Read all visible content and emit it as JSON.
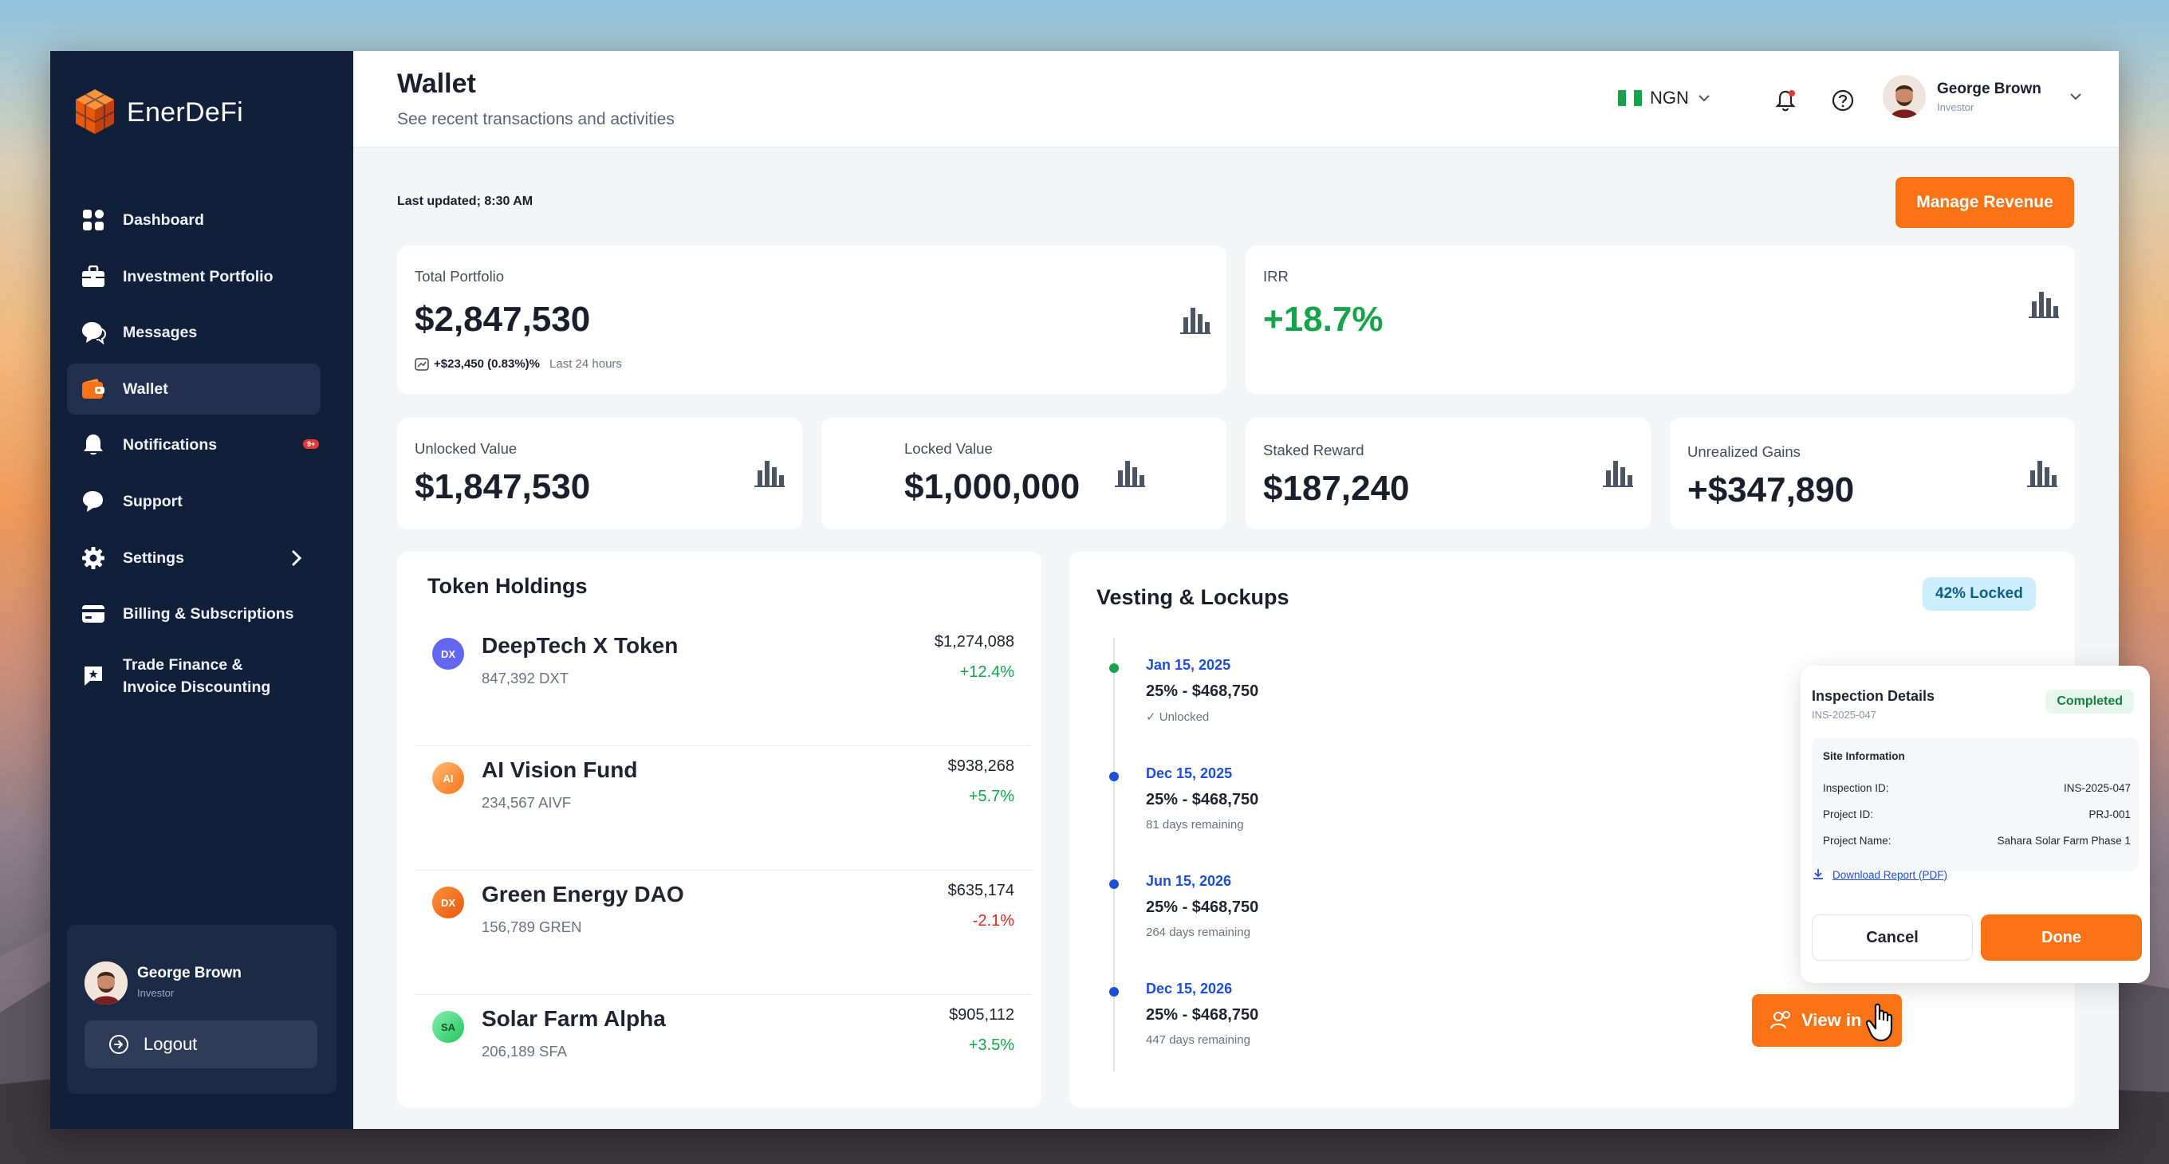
{
  "brand": {
    "name": "EnerDeFi"
  },
  "sidebar": {
    "items": [
      {
        "label": "Dashboard",
        "icon": "grid-icon"
      },
      {
        "label": "Investment Portfolio",
        "icon": "briefcase-icon"
      },
      {
        "label": "Messages",
        "icon": "chat-icon"
      },
      {
        "label": "Wallet",
        "icon": "wallet-icon",
        "active": true
      },
      {
        "label": "Notifications",
        "icon": "bell-icon",
        "badge": "9+"
      },
      {
        "label": "Support",
        "icon": "support-icon"
      },
      {
        "label": "Settings",
        "icon": "gear-icon"
      },
      {
        "label": "Billing & Subscriptions",
        "icon": "card-icon"
      },
      {
        "label": "Trade Finance & Invoice Discounting",
        "icon": "invoice-icon"
      }
    ],
    "user": {
      "name": "George Brown",
      "role": "Investor"
    },
    "logout_label": "Logout"
  },
  "header": {
    "title": "Wallet",
    "subtitle": "See recent transactions and activities",
    "currency": "NGN",
    "user": {
      "name": "George Brown",
      "role": "Investor"
    }
  },
  "last_updated": "Last updated; 8:30 AM",
  "manage_revenue_label": "Manage Revenue",
  "stats": {
    "total_portfolio": {
      "label": "Total Portfolio",
      "value": "$2,847,530",
      "change": "+$23,450 (0.83%)%",
      "period": "Last 24 hours"
    },
    "irr": {
      "label": "IRR",
      "value": "+18.7%"
    },
    "unlocked": {
      "label": "Unlocked Value",
      "value": "$1,847,530"
    },
    "locked": {
      "label": "Locked Value",
      "value": "$1,000,000"
    },
    "staked": {
      "label": "Staked Reward",
      "value": "$187,240"
    },
    "unrealized": {
      "label": "Unrealized Gains",
      "value": "+$347,890"
    }
  },
  "token_holdings": {
    "title": "Token Holdings",
    "items": [
      {
        "initials": "DX",
        "name": "DeepTech X Token",
        "amount": "847,392 DXT",
        "value": "$1,274,088",
        "change": "+12.4%",
        "color": "#6366f1",
        "change_color": "#16a34a"
      },
      {
        "initials": "AI",
        "name": "AI Vision Fund",
        "amount": "234,567 AIVF",
        "value": "$938,268",
        "change": "+5.7%",
        "color": "#fb923c",
        "change_color": "#16a34a"
      },
      {
        "initials": "DX",
        "name": "Green Energy DAO",
        "amount": "156,789 GREN",
        "value": "$635,174",
        "change": "-2.1%",
        "color": "#f97316",
        "change_color": "#dc2626"
      },
      {
        "initials": "SA",
        "name": "Solar Farm Alpha",
        "amount": "206,189 SFA",
        "value": "$905,112",
        "change": "+3.5%",
        "color": "#4ade80",
        "change_color": "#16a34a"
      }
    ]
  },
  "vesting": {
    "title": "Vesting & Lockups",
    "badge": "42% Locked",
    "items": [
      {
        "date": "Jan 15, 2025",
        "amount": "25% - $468,750",
        "note": "✓ Unlocked",
        "dot": "#16a34a"
      },
      {
        "date": "Dec 15, 2025",
        "amount": "25% - $468,750",
        "note": "81 days remaining",
        "dot": "#1d4ed8"
      },
      {
        "date": "Jun 15, 2026",
        "amount": "25% - $468,750",
        "note": "264 days remaining",
        "dot": "#1d4ed8"
      },
      {
        "date": "Dec 15, 2026",
        "amount": "25% - $468,750",
        "note": "447 days remaining",
        "dot": "#1d4ed8"
      }
    ]
  },
  "inspection": {
    "title": "Inspection Details",
    "id": "INS-2025-047",
    "status": "Completed",
    "section": "Site Information",
    "rows": [
      {
        "label": "Inspection ID:",
        "value": "INS-2025-047"
      },
      {
        "label": "Project ID:",
        "value": "PRJ-001"
      },
      {
        "label": "Project Name:",
        "value": "Sahara Solar Farm Phase 1"
      }
    ],
    "download": "Download Report (PDF)",
    "cancel": "Cancel",
    "done": "Done"
  },
  "view_button": "View in"
}
